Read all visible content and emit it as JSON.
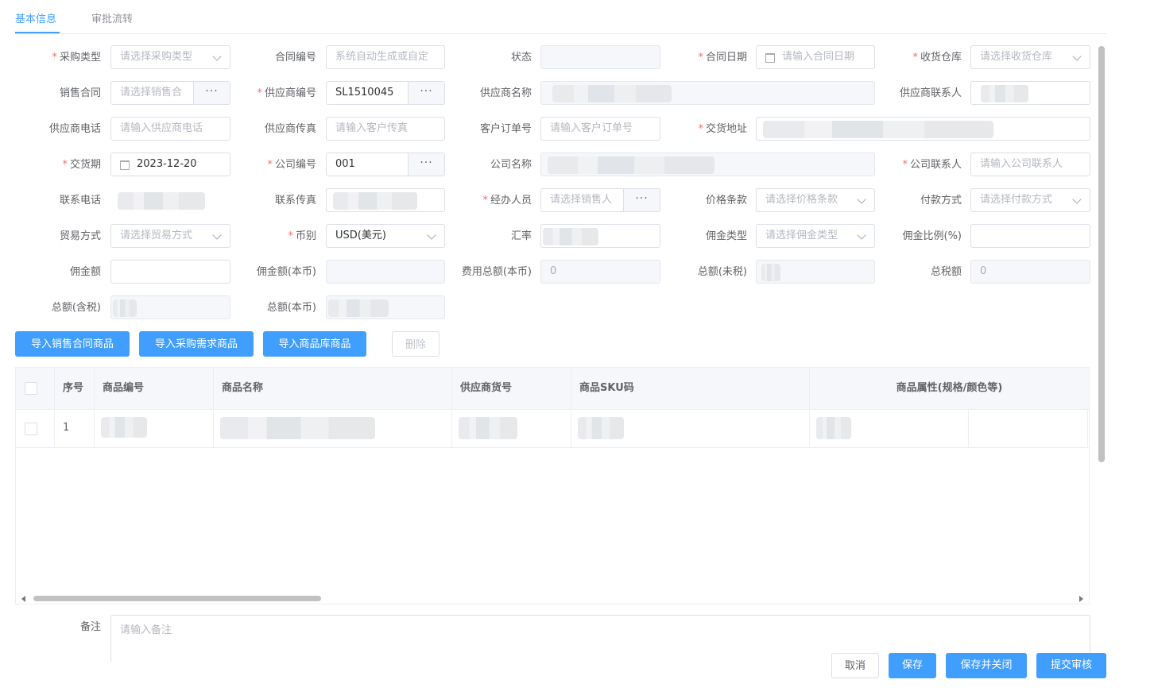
{
  "tabs": [
    {
      "label": "基本信息",
      "active": true
    },
    {
      "label": "审批流转",
      "active": false
    }
  ],
  "form": {
    "purchase_type": {
      "label": "采购类型",
      "placeholder": "请选择采购类型"
    },
    "contract_no": {
      "label": "合同编号",
      "placeholder": "系统自动生成或自定"
    },
    "status": {
      "label": "状态",
      "value": ""
    },
    "contract_date": {
      "label": "合同日期",
      "placeholder": "请输入合同日期"
    },
    "warehouse": {
      "label": "收货仓库",
      "placeholder": "请选择收货仓库"
    },
    "sales_contract": {
      "label": "销售合同",
      "placeholder": "请选择销售合"
    },
    "supplier_no": {
      "label": "供应商编号",
      "value": "SL1510045"
    },
    "supplier_name": {
      "label": "供应商名称"
    },
    "supplier_contact": {
      "label": "供应商联系人"
    },
    "supplier_phone": {
      "label": "供应商电话",
      "placeholder": "请输入供应商电话"
    },
    "supplier_fax": {
      "label": "供应商传真",
      "placeholder": "请输入客户传真"
    },
    "customer_order_no": {
      "label": "客户订单号",
      "placeholder": "请输入客户订单号"
    },
    "delivery_address": {
      "label": "交货地址"
    },
    "delivery_date": {
      "label": "交货期",
      "value": "2023-12-20"
    },
    "company_no": {
      "label": "公司编号",
      "value": "001"
    },
    "company_name": {
      "label": "公司名称"
    },
    "company_contact": {
      "label": "公司联系人",
      "placeholder": "请输入公司联系人"
    },
    "contact_phone": {
      "label": "联系电话"
    },
    "contact_fax": {
      "label": "联系传真"
    },
    "handler": {
      "label": "经办人员",
      "placeholder": "请选择销售人"
    },
    "price_terms": {
      "label": "价格条款",
      "placeholder": "请选择价格条款"
    },
    "payment_method": {
      "label": "付款方式",
      "placeholder": "请选择付款方式"
    },
    "trade_method": {
      "label": "贸易方式",
      "placeholder": "请选择贸易方式"
    },
    "currency": {
      "label": "币别",
      "value": "USD(美元)"
    },
    "exchange_rate": {
      "label": "汇率"
    },
    "commission_type": {
      "label": "佣金类型",
      "placeholder": "请选择佣金类型"
    },
    "commission_ratio": {
      "label": "佣金比例(%)",
      "value": ""
    },
    "commission_amount": {
      "label": "佣金额",
      "value": ""
    },
    "commission_local": {
      "label": "佣金额(本币)",
      "value": ""
    },
    "expense_total_local": {
      "label": "费用总额(本币)",
      "value": "0"
    },
    "total_excl_tax": {
      "label": "总额(未税)"
    },
    "total_tax": {
      "label": "总税额",
      "value": "0"
    },
    "total_incl_tax": {
      "label": "总额(含税)"
    },
    "total_local": {
      "label": "总额(本币)"
    }
  },
  "actions": {
    "import_sales": "导入销售合同商品",
    "import_purchase": "导入采购需求商品",
    "import_library": "导入商品库商品",
    "delete": "删除"
  },
  "table": {
    "columns": [
      "序号",
      "商品编号",
      "商品名称",
      "供应商货号",
      "商品SKU码",
      "商品属性(规格/颜色等)"
    ],
    "rows": [
      {
        "index": "1"
      }
    ]
  },
  "remark": {
    "label": "备注",
    "placeholder": "请输入备注"
  },
  "footer": {
    "cancel": "取消",
    "save": "保存",
    "save_close": "保存并关闭",
    "submit": "提交审核"
  },
  "colors": {
    "primary": "#409eff",
    "required": "#f56c6c"
  }
}
